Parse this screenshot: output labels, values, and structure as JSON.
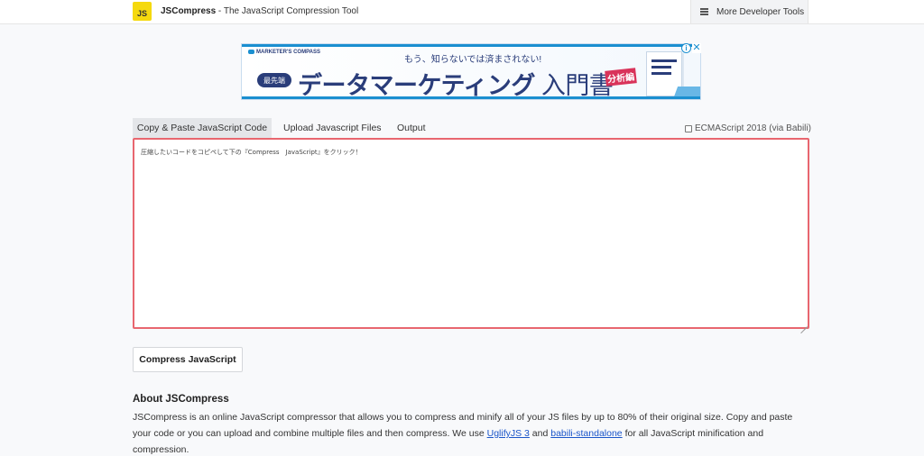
{
  "header": {
    "logo_text": "JS",
    "brand_name": "JSCompress",
    "brand_suffix": " - The JavaScript Compression Tool",
    "more_tools_label": "More Developer Tools"
  },
  "ad": {
    "brand": "MARKETER'S COMPASS",
    "tagline": "もう、知らないでは済まされない!",
    "badge": "最先端",
    "headline": "データマーケティング",
    "headline_suffix": "入門書",
    "tag": "分析編",
    "info_icon": "i",
    "close_icon": "✕",
    "colors": {
      "primary": "#2a3d7a",
      "accent": "#1b8fd0",
      "tag": "#d9335a"
    }
  },
  "tabs": [
    {
      "label": "Copy & Paste JavaScript Code",
      "active": true
    },
    {
      "label": "Upload Javascript Files",
      "active": false
    },
    {
      "label": "Output",
      "active": false
    }
  ],
  "options": {
    "ecma_label": "ECMAScript 2018 (via Babili)",
    "ecma_checked": false
  },
  "editor": {
    "value": "圧縮したいコードをコピペして下の『Compress　JavaScript』をクリック！",
    "border_color": "#e8666f"
  },
  "actions": {
    "compress_label": "Compress JavaScript"
  },
  "about": {
    "title": "About JSCompress",
    "text_1": "JSCompress is an online JavaScript compressor that allows you to compress and minify all of your JS files by up to 80% of their original size. Copy and paste your code or you can upload and combine multiple files and then compress. We use ",
    "link_1": "UglifyJS 3",
    "text_2": " and ",
    "link_2": "babili-standalone",
    "text_3": " for all JavaScript minification and compression."
  }
}
